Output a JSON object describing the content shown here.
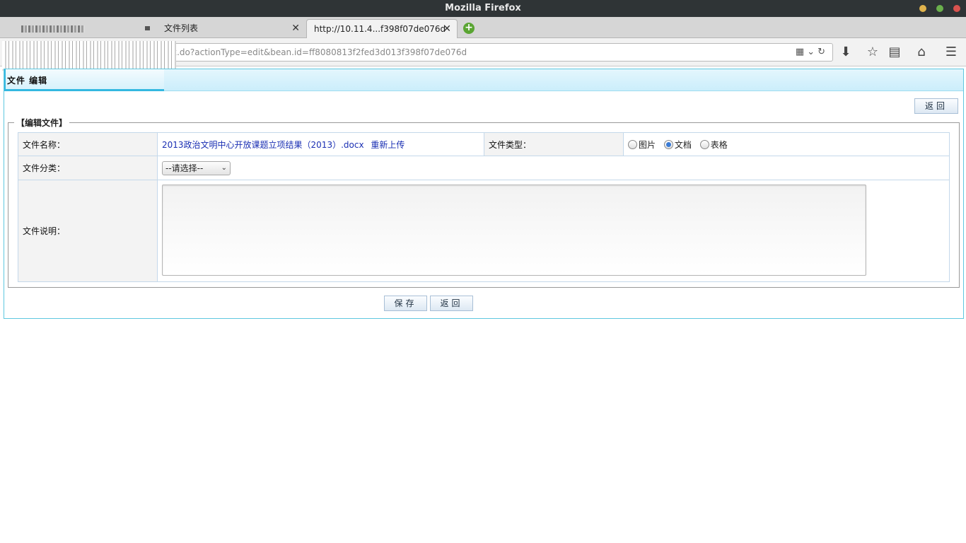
{
  "window": {
    "title": "Mozilla Firefox",
    "controls": [
      "#e0b34c",
      "#6ab04c",
      "#d9534f"
    ]
  },
  "tabs": [
    {
      "label": "",
      "blurred": true
    },
    {
      "label": "文件列表"
    },
    {
      "label": "http://10.11.4...f398f07de076d",
      "active": true
    }
  ],
  "tab_close_glyph": "✕",
  "new_tab_glyph": "+",
  "urlbar": {
    "visible_url": "x.do?actionType=edit&bean.id=ff8080813f2fed3d013f398f07de076d"
  },
  "page": {
    "header_title": "文件 编辑",
    "back_top_label": "返回",
    "fieldset_legend": "【编辑文件】",
    "form": {
      "file_name_label": "文件名称：",
      "file_name_value": "2013政治文明中心开放课题立项结果（2013）.docx",
      "reupload_label": "重新上传",
      "file_type_label": "文件类型：",
      "file_type_options": [
        {
          "label": "图片",
          "checked": false
        },
        {
          "label": "文档",
          "checked": true
        },
        {
          "label": "表格",
          "checked": false
        }
      ],
      "category_label": "文件分类：",
      "category_selected": "--请选择--",
      "description_label": "文件说明：",
      "description_value": ""
    },
    "save_label": "保存",
    "back_bottom_label": "返回"
  }
}
